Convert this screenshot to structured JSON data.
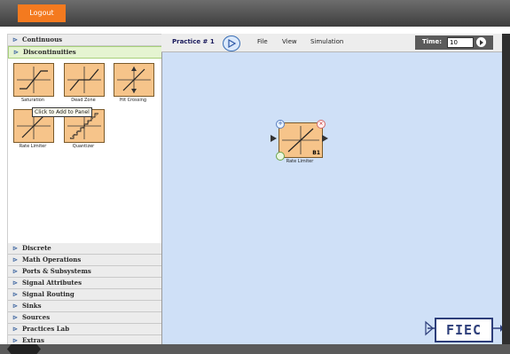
{
  "header": {
    "logout_label": "Logout"
  },
  "library": {
    "open_categories": [
      {
        "label": "Continuous"
      },
      {
        "label": "Discontinuities"
      }
    ],
    "blocks": [
      {
        "label": "Saturation"
      },
      {
        "label": "Dead Zone"
      },
      {
        "label": "Hit Crossing"
      },
      {
        "label": "Rate Limiter"
      },
      {
        "label": "Quantizer"
      }
    ],
    "tooltip": "Click to Add to Panel",
    "categories": [
      {
        "label": "Discrete"
      },
      {
        "label": "Math Operations"
      },
      {
        "label": "Ports & Subsystems"
      },
      {
        "label": "Signal Attributes"
      },
      {
        "label": "Signal Routing"
      },
      {
        "label": "Sinks"
      },
      {
        "label": "Sources"
      },
      {
        "label": "Practices Lab"
      },
      {
        "label": "Extras"
      }
    ]
  },
  "toolbar": {
    "practice_label": "Practice # 1",
    "menu": [
      {
        "label": "File"
      },
      {
        "label": "View"
      },
      {
        "label": "Simulation"
      }
    ],
    "time_label": "Time:",
    "time_value": "10"
  },
  "canvas": {
    "block": {
      "label": "Rate Limiter",
      "id": "B1",
      "plus": "+",
      "cross": "×"
    },
    "logo_text": "FIEC"
  },
  "icons": {
    "category_icon": "port-arrow-icon",
    "play_icon": "play-circle-icon",
    "run_icon": "run-icon"
  },
  "colors": {
    "accent": "#f47a1f",
    "canvas_bg": "#cfe0f7",
    "block_bg": "#f6c48a",
    "selected_category_bg": "#e5f4d1"
  }
}
